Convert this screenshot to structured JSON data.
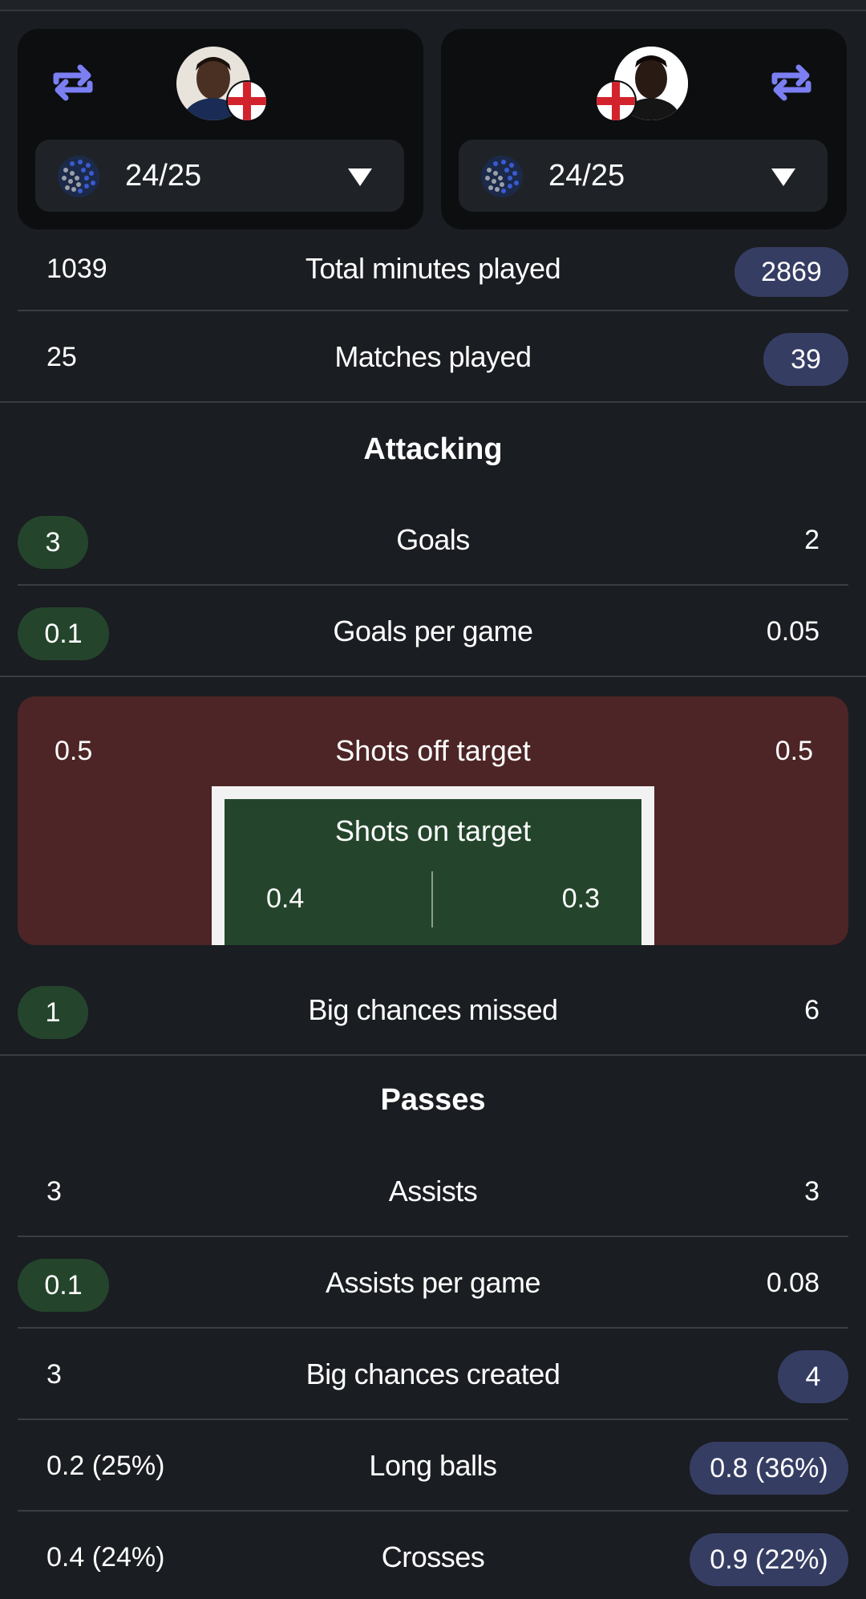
{
  "players": {
    "left": {
      "season": "24/25",
      "flag": "england-flag"
    },
    "right": {
      "season": "24/25",
      "flag": "england-flag"
    }
  },
  "overview": [
    {
      "label": "Total minutes played",
      "left": "1039",
      "right": "2869",
      "highlight": "right"
    },
    {
      "label": "Matches played",
      "left": "25",
      "right": "39",
      "highlight": "right"
    }
  ],
  "attacking": {
    "title": "Attacking",
    "goals": {
      "label": "Goals",
      "left": "3",
      "right": "2",
      "highlight": "left"
    },
    "goals_per_game": {
      "label": "Goals per game",
      "left": "0.1",
      "right": "0.05",
      "highlight": "left"
    },
    "shots_off_target": {
      "label": "Shots off target",
      "left": "0.5",
      "right": "0.5"
    },
    "shots_on_target": {
      "label": "Shots on target",
      "left": "0.4",
      "right": "0.3"
    },
    "big_chances_missed": {
      "label": "Big chances missed",
      "left": "1",
      "right": "6",
      "highlight": "left"
    }
  },
  "passes": {
    "title": "Passes",
    "rows": [
      {
        "label": "Assists",
        "left": "3",
        "right": "3",
        "highlight": "none"
      },
      {
        "label": "Assists per game",
        "left": "0.1",
        "right": "0.08",
        "highlight": "left"
      },
      {
        "label": "Big chances created",
        "left": "3",
        "right": "4",
        "highlight": "right"
      },
      {
        "label": "Long balls",
        "left": "0.2 (25%)",
        "right": "0.8 (36%)",
        "highlight": "right"
      },
      {
        "label": "Crosses",
        "left": "0.4 (24%)",
        "right": "0.9 (22%)",
        "highlight": "right"
      }
    ]
  },
  "colors": {
    "background": "#1a1d21",
    "card": "#0c0e10",
    "left_highlight": "#24452c",
    "right_highlight": "#363d63",
    "shots_off_bg": "#4d2526",
    "swap_icon": "#7b7ff2"
  },
  "icons": [
    "swap-icon",
    "avatar",
    "england-flag-icon",
    "league-logo-icon",
    "dropdown-caret-icon"
  ]
}
